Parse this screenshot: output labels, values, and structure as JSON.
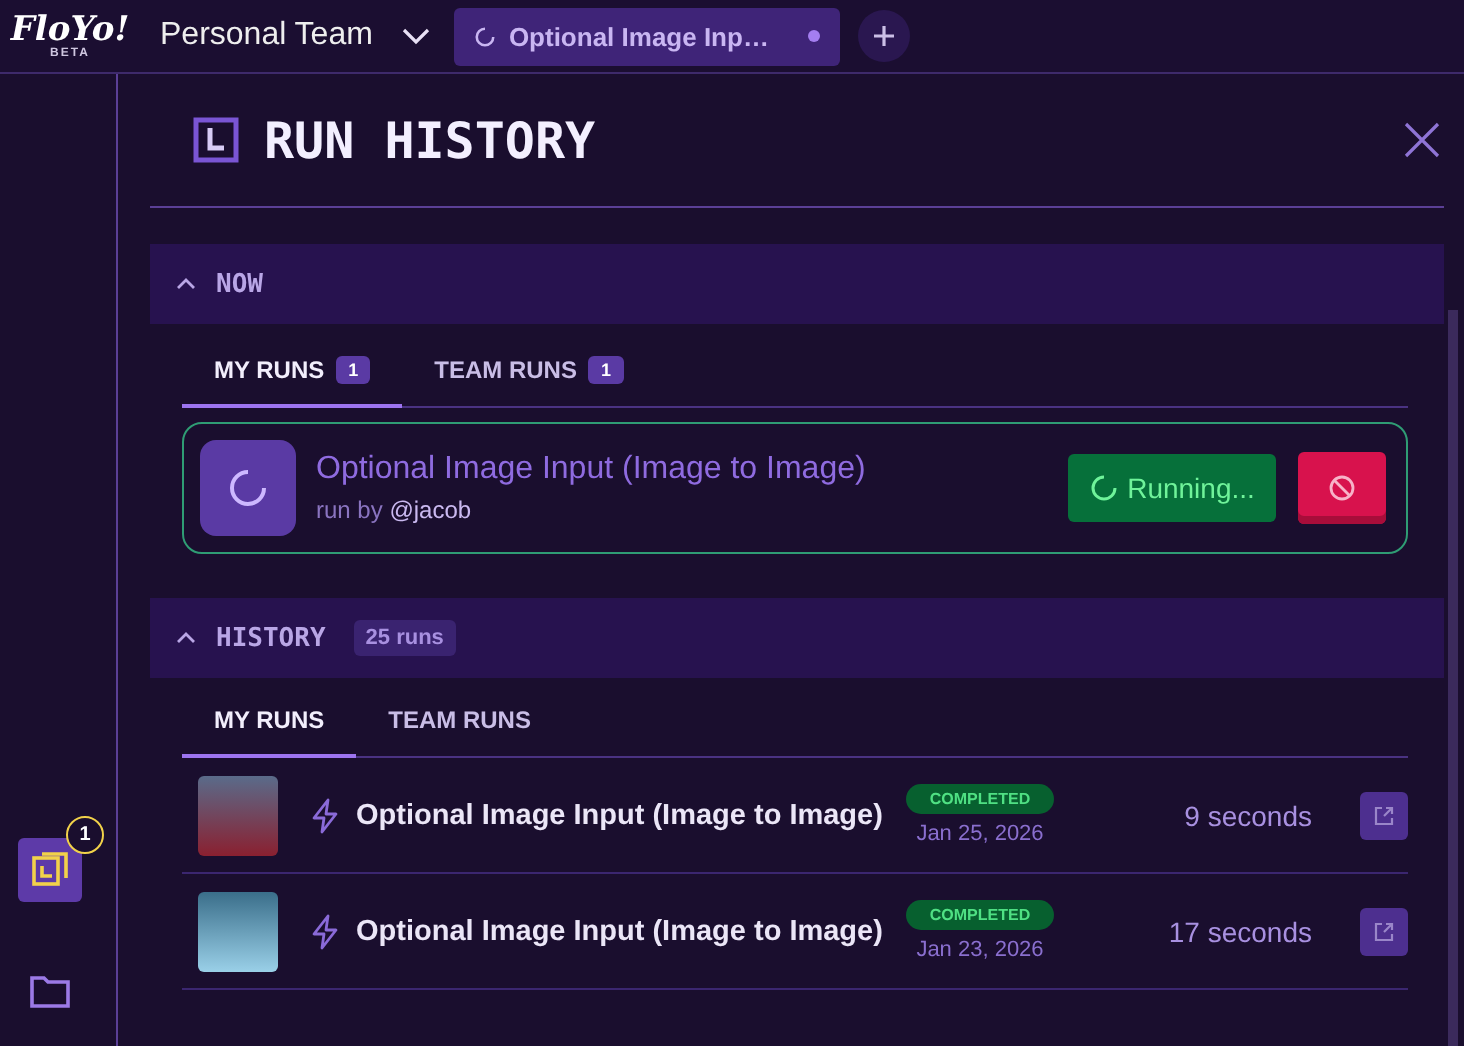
{
  "topbar": {
    "logo": "FloYo!",
    "logo_tag": "BETA",
    "team": "Personal Team",
    "tabs": [
      {
        "label": "Optional Image Inp…",
        "selected": true
      }
    ]
  },
  "sidebar": {
    "items": [
      {
        "kind": "history",
        "selected": true,
        "badge": "1"
      },
      {
        "kind": "folder",
        "selected": false
      }
    ]
  },
  "panel": {
    "title": "RUN HISTORY",
    "now": {
      "title": "NOW",
      "expanded": true,
      "tabs": [
        {
          "label": "MY RUNS",
          "count": "1",
          "selected": true
        },
        {
          "label": "TEAM RUNS",
          "count": "1",
          "selected": false
        }
      ],
      "runs": [
        {
          "title": "Optional Image Input (Image to Image)",
          "by": "run by",
          "user": "@jacob",
          "status": "Running..."
        }
      ]
    },
    "history": {
      "title": "HISTORY",
      "expanded": true,
      "count": "25 runs",
      "tabs": [
        {
          "label": "MY RUNS",
          "selected": true
        },
        {
          "label": "TEAM RUNS",
          "selected": false
        }
      ],
      "runs": [
        {
          "title": "Optional Image Input (Image to Image)",
          "status": "COMPLETED",
          "date": "Jan 25, 2026",
          "duration": "9 seconds"
        },
        {
          "title": "Optional Image Input (Image to Image)",
          "status": "COMPLETED",
          "date": "Jan 23, 2026",
          "duration": "17 seconds"
        }
      ]
    }
  }
}
